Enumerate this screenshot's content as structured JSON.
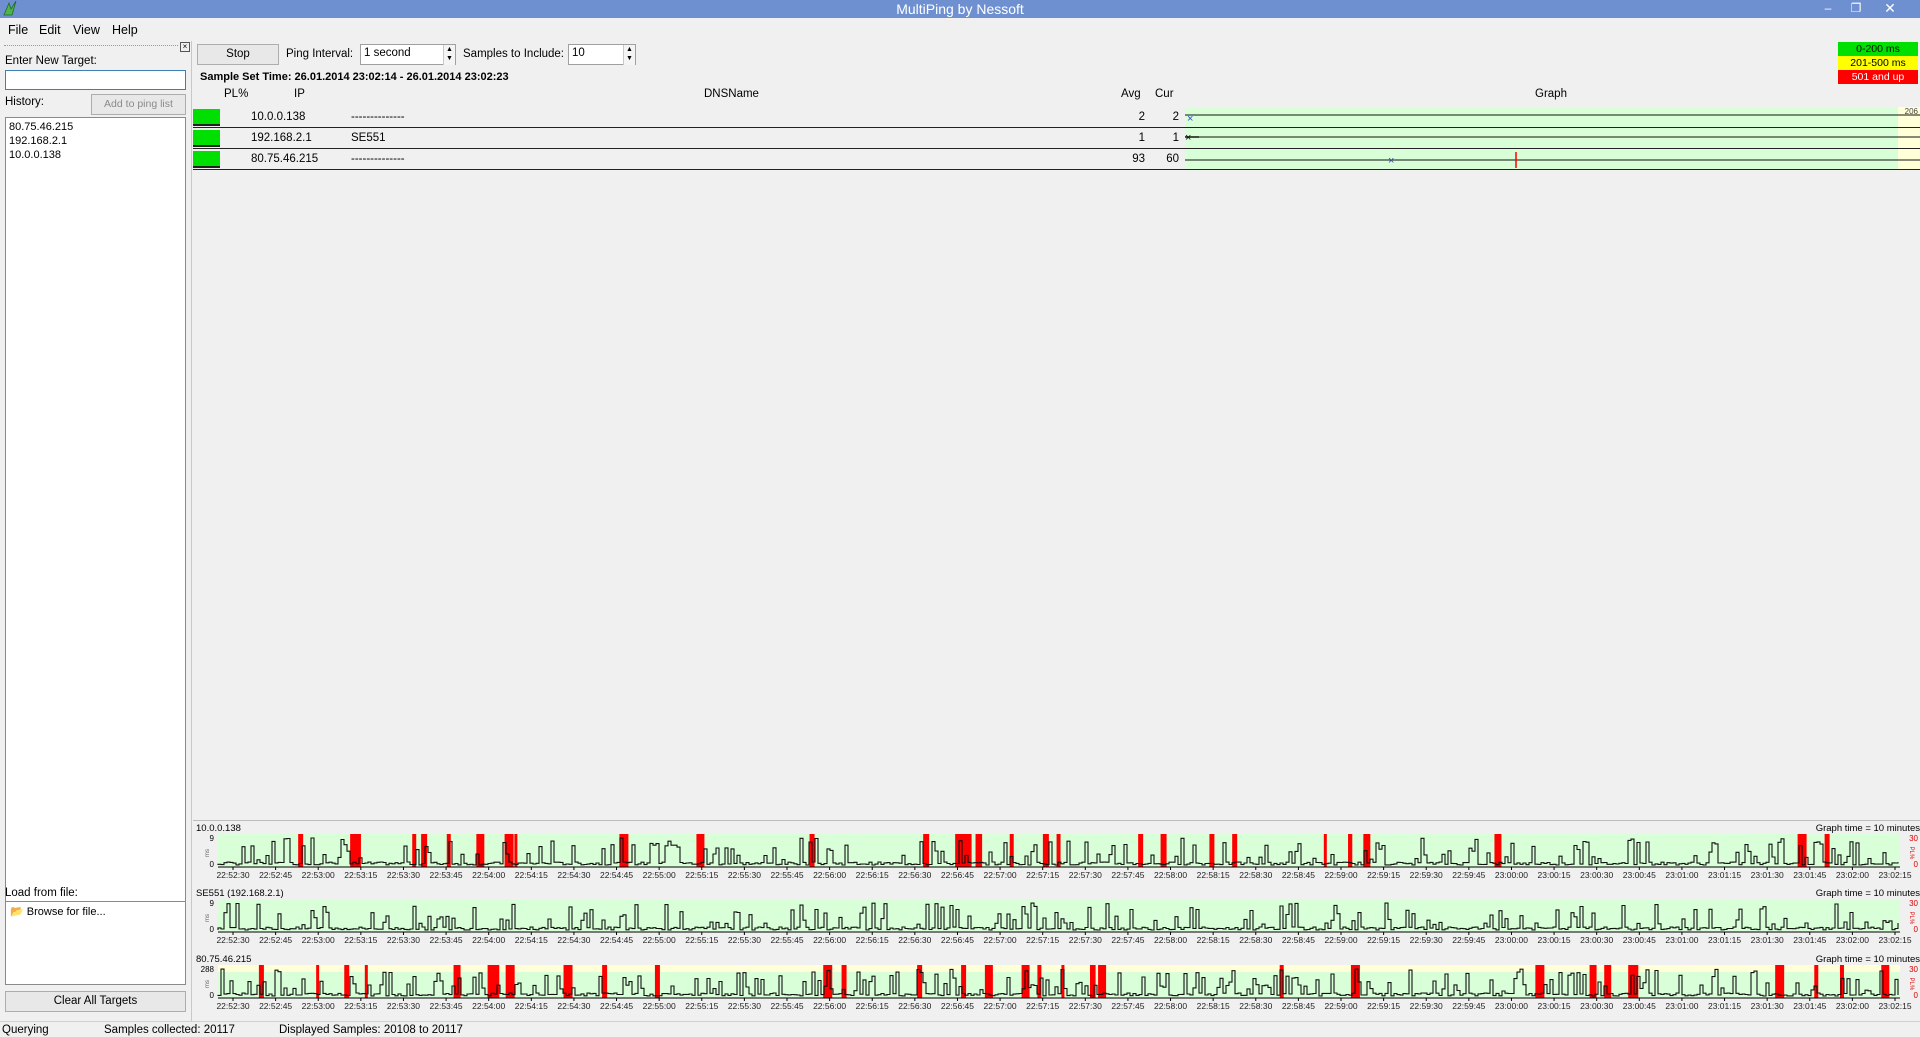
{
  "window": {
    "title": "MultiPing by Nessoft"
  },
  "menu": [
    "File",
    "Edit",
    "View",
    "Help"
  ],
  "sidebar": {
    "enter_target_label": "Enter New Target:",
    "target_value": "",
    "history_label": "History:",
    "add_button": "Add to ping list",
    "history": [
      "80.75.46.215",
      "192.168.2.1",
      "10.0.0.138"
    ],
    "load_label": "Load from file:",
    "browse_label": "Browse for file...",
    "clear_button": "Clear All Targets"
  },
  "toolbar": {
    "stop_button": "Stop",
    "interval_label": "Ping Interval:",
    "interval_value": "1 second",
    "samples_label": "Samples to Include:",
    "samples_value": "10",
    "sample_set_time": "Sample Set Time: 26.01.2014 23:02:14 - 26.01.2014 23:02:23"
  },
  "legend": [
    {
      "label": "0-200 ms",
      "color": "#00e000"
    },
    {
      "label": "201-500 ms",
      "color": "#ffff00"
    },
    {
      "label": "501 and up",
      "color": "#ff0000"
    }
  ],
  "columns": {
    "pl": "PL%",
    "ip": "IP",
    "dns": "DNSName",
    "avg": "Avg",
    "cur": "Cur",
    "graph": "Graph"
  },
  "graph_scale_max": "206",
  "targets": [
    {
      "ip": "10.0.0.138",
      "dns": "--------------",
      "avg": "2",
      "cur": "2",
      "status_color": "#00e000"
    },
    {
      "ip": "192.168.2.1",
      "dns": "SE551",
      "avg": "1",
      "cur": "1",
      "status_color": "#00e000"
    },
    {
      "ip": "80.75.46.215",
      "dns": "--------------",
      "avg": "93",
      "cur": "60",
      "status_color": "#00e000"
    }
  ],
  "history_graphs": {
    "graph_time_label": "Graph time = 10 minutes",
    "y_unit": "ms",
    "pl_unit": "PL%",
    "time_labels": [
      "22:52:30",
      "22:52:45",
      "22:53:00",
      "22:53:15",
      "22:53:30",
      "22:53:45",
      "22:54:00",
      "22:54:15",
      "22:54:30",
      "22:54:45",
      "22:55:00",
      "22:55:15",
      "22:55:30",
      "22:55:45",
      "22:56:00",
      "22:56:15",
      "22:56:30",
      "22:56:45",
      "22:57:00",
      "22:57:15",
      "22:57:30",
      "22:57:45",
      "22:58:00",
      "22:58:15",
      "22:58:30",
      "22:58:45",
      "22:59:00",
      "22:59:15",
      "22:59:30",
      "22:59:45",
      "23:00:00",
      "23:00:15",
      "23:00:30",
      "23:00:45",
      "23:01:00",
      "23:01:15",
      "23:01:30",
      "23:01:45",
      "23:02:00",
      "23:02:15"
    ],
    "panels": [
      {
        "name": "10.0.0.138",
        "y_max": "9",
        "y_min": "0",
        "pl_max": "30",
        "pl_min": "0"
      },
      {
        "name": "SE551 (192.168.2.1)",
        "y_max": "9",
        "y_min": "0",
        "pl_max": "30",
        "pl_min": "0"
      },
      {
        "name": "80.75.46.215",
        "y_max": "288",
        "y_min": "0",
        "pl_max": "30",
        "pl_min": "0"
      }
    ]
  },
  "status": {
    "state": "Querying",
    "collected": "Samples collected: 20117",
    "displayed": "Displayed Samples: 20108 to 20117"
  }
}
